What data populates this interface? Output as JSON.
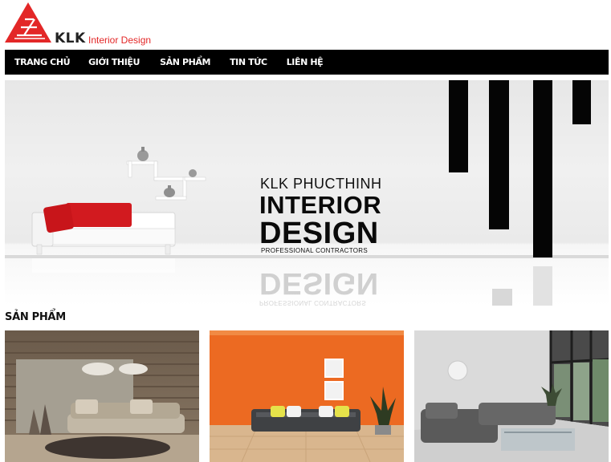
{
  "header": {
    "brand": "KLK",
    "brand_sub": "Interior Design"
  },
  "nav": {
    "items": [
      {
        "label": "TRANG CHỦ"
      },
      {
        "label": "GIỚI THIỆU"
      },
      {
        "label": "SẢN PHẨM"
      },
      {
        "label": "TIN TỨC"
      },
      {
        "label": "LIÊN HỆ"
      }
    ]
  },
  "banner": {
    "line1": "KLK PHUCTHINH",
    "line2": "INTERIOR",
    "line3": "DESIGN",
    "tagline": "PROFESSIONAL CONTRACTORS"
  },
  "products": {
    "title": "SẢN PHẨM"
  },
  "colors": {
    "brand_red": "#e32727",
    "nav_bg": "#000000",
    "nav_text": "#ffffff"
  }
}
